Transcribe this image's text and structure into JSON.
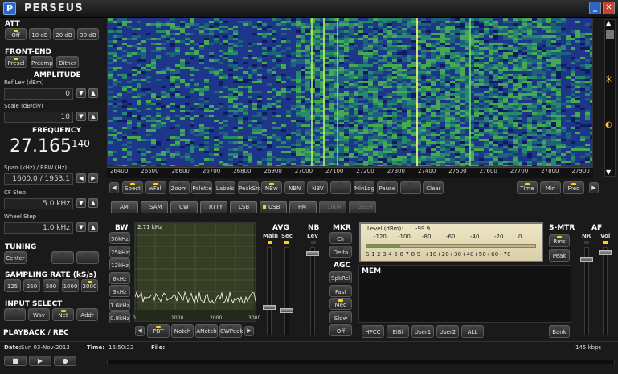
{
  "app": {
    "title": "PERSEUS"
  },
  "left": {
    "att": {
      "title": "ATT",
      "buttons": [
        {
          "label": "Off",
          "on": true
        },
        {
          "label": "10 dB",
          "on": false
        },
        {
          "label": "20 dB",
          "on": false
        },
        {
          "label": "30 dB",
          "on": false
        }
      ]
    },
    "frontend": {
      "title": "FRONT-END",
      "buttons": [
        {
          "label": "Presel",
          "on": true
        },
        {
          "label": "Preamp",
          "on": false
        },
        {
          "label": "Dither",
          "on": false
        }
      ]
    },
    "amplitude": {
      "title": "AMPLITUDE",
      "ref_label": "Ref Lev (dBm)",
      "ref_value": "0",
      "scale_label": "Scale (dB/div)",
      "scale_value": "10"
    },
    "frequency": {
      "title": "FREQUENCY",
      "main": "27.165",
      "fraction": "140",
      "span_label": "Span (kHz) / RBW (Hz)",
      "span_value": "1600.0 / 1953.1",
      "cf_label": "CF Step",
      "cf_value": "5.0 kHz",
      "wheel_label": "Wheel Step",
      "wheel_value": "1.0 kHz"
    },
    "tuning": {
      "title": "TUNING",
      "center": "Center"
    },
    "sampling": {
      "title": "SAMPLING RATE (kS/s)",
      "buttons": [
        {
          "label": "125",
          "on": false
        },
        {
          "label": "250",
          "on": false
        },
        {
          "label": "500",
          "on": false
        },
        {
          "label": "1000",
          "on": false
        },
        {
          "label": "2000",
          "on": true
        }
      ]
    },
    "input": {
      "title": "INPUT SELECT",
      "buttons": [
        {
          "label": "",
          "on": false
        },
        {
          "label": "Wav",
          "on": false
        },
        {
          "label": "Net",
          "on": true
        },
        {
          "label": "Addr",
          "on": false
        }
      ]
    },
    "playback": {
      "title": "PLAYBACK / REC"
    }
  },
  "scale": {
    "ticks": [
      "26400",
      "26500",
      "26600",
      "26700",
      "26800",
      "26900",
      "27000",
      "27100",
      "27200",
      "27300",
      "27400",
      "27500",
      "27600",
      "27700",
      "27800",
      "27900"
    ]
  },
  "toolbar": {
    "left": [
      {
        "label": "Spect",
        "on": true
      },
      {
        "label": "wFall",
        "on": true
      },
      {
        "label": "Zoom",
        "on": false
      },
      {
        "label": "Palette",
        "on": false
      },
      {
        "label": "Labels",
        "on": false
      },
      {
        "label": "PeakSrc",
        "on": false
      },
      {
        "label": "NBw",
        "on": true
      },
      {
        "label": "NBN",
        "on": false
      },
      {
        "label": "NBV",
        "on": false
      },
      {
        "label": "",
        "on": false
      },
      {
        "label": "MinLog",
        "on": false
      },
      {
        "label": "Pause",
        "on": false
      },
      {
        "label": "",
        "on": false
      },
      {
        "label": "Clear",
        "on": false
      }
    ],
    "right": [
      {
        "label": "Time",
        "on": true
      },
      {
        "label": "Min",
        "on": false
      },
      {
        "label": "Freq",
        "on": true
      }
    ]
  },
  "modes": [
    {
      "label": "AM",
      "on": false,
      "dis": false
    },
    {
      "label": "SAM",
      "on": false,
      "dis": false
    },
    {
      "label": "CW",
      "on": false,
      "dis": false
    },
    {
      "label": "RTTY",
      "on": false,
      "dis": false
    },
    {
      "label": "LSB",
      "on": false,
      "dis": false
    },
    {
      "label": "USB",
      "on": true,
      "dis": false
    },
    {
      "label": "FM",
      "on": false,
      "dis": false
    },
    {
      "label": "DRM",
      "on": false,
      "dis": true
    },
    {
      "label": "USER",
      "on": false,
      "dis": true
    }
  ],
  "bw": {
    "title": "BW",
    "buttons": [
      "50kHz",
      "25kHz",
      "12kHz",
      "6kHz",
      "3kHz",
      "1.6kHz",
      "0.8kHz"
    ],
    "readout": "2.71 kHz",
    "axis": [
      "0",
      "1000",
      "2000",
      "3000"
    ],
    "bottom": [
      {
        "label": "PBT",
        "on": true
      },
      {
        "label": "Notch",
        "on": false
      },
      {
        "label": "ANotch",
        "on": false
      },
      {
        "label": "CWPeak",
        "on": false
      }
    ]
  },
  "avg": {
    "title": "AVG",
    "main": "Main",
    "sec": "Sec"
  },
  "nb": {
    "title": "NB",
    "lev": "Lev"
  },
  "mkr": {
    "title": "MKR",
    "buttons": [
      "Clr",
      "Delta"
    ]
  },
  "agc": {
    "title": "AGC",
    "buttons": [
      {
        "label": "SpkRel",
        "on": false
      },
      {
        "label": "Fast",
        "on": false
      },
      {
        "label": "Med",
        "on": true
      },
      {
        "label": "Slow",
        "on": false
      },
      {
        "label": "Off",
        "on": false
      }
    ]
  },
  "meter": {
    "level_label": "Level (dBm):",
    "level_value": "-99.9",
    "dbm_scale": [
      "-120",
      "-100",
      "-80",
      "-60",
      "-40",
      "-20",
      "0"
    ],
    "s_scale": "S 1 2 3 4 5 6 7 8 9  +10+20+30+40+50+60+70",
    "level_fraction": 0.2
  },
  "smtr": {
    "title": "S-MTR",
    "rms": "Rms",
    "peak": "Peak"
  },
  "af": {
    "title": "AF",
    "nr": "NR",
    "vol": "Vol"
  },
  "mem": {
    "title": "MEM",
    "buttons": [
      {
        "label": "HFCC",
        "on": false
      },
      {
        "label": "EiBi",
        "on": false
      },
      {
        "label": "User1",
        "on": false
      },
      {
        "label": "User2",
        "on": false
      },
      {
        "label": "ALL",
        "on": false
      }
    ],
    "bank": "Bank"
  },
  "status": {
    "date_label": "Date:",
    "date_value": "Sun 03-Nov-2013",
    "time_label": "Time:",
    "time_value": "16:50:22",
    "file_label": "File:",
    "rate": "145 kbps"
  },
  "colors": {
    "waterfall_bg": "#19237a",
    "accent": "#ffd400",
    "meter_bg": "#e8dfbd"
  }
}
